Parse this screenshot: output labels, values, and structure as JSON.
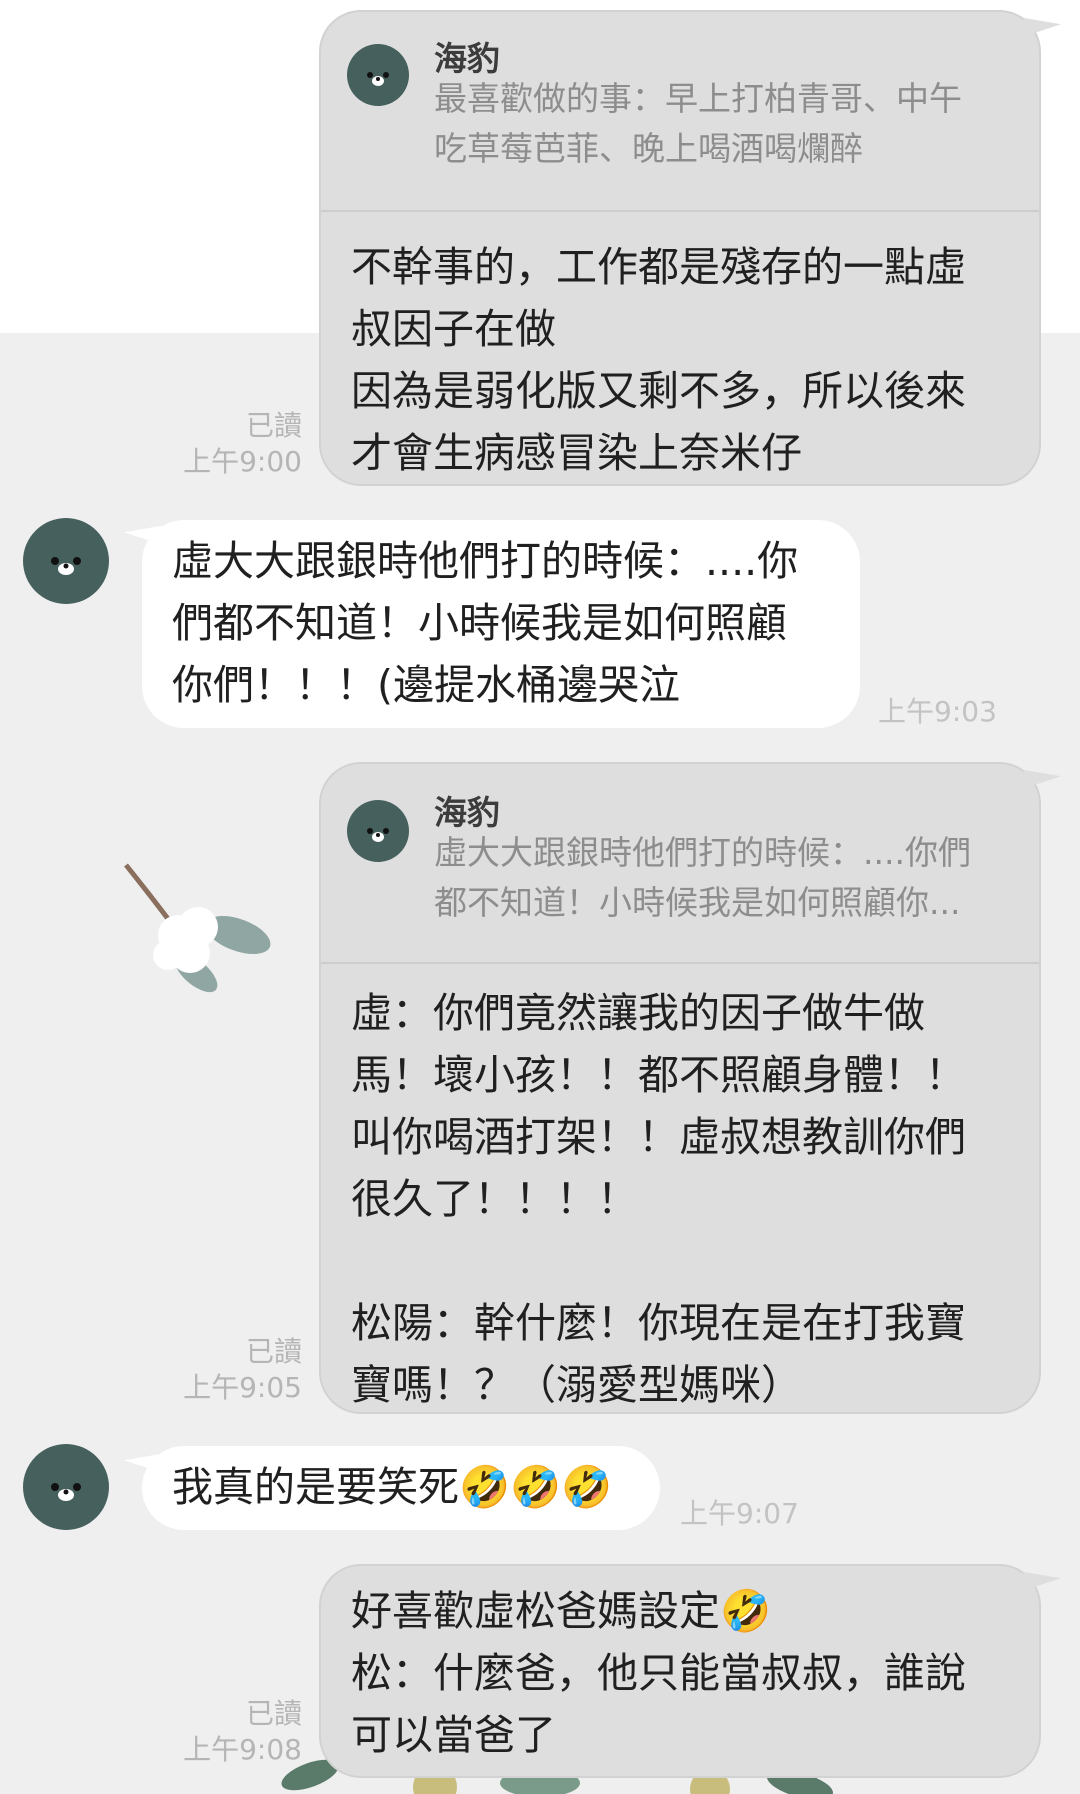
{
  "messages": [
    {
      "reply_name": "海豹",
      "reply_text": "最喜歡做的事：早上打柏青哥、中午\n吃草莓芭菲、晚上喝酒喝爛醉",
      "text": "不幹事的，工作都是殘存的一點虛\n叔因子在做\n因為是弱化版又剩不多，所以後來\n才會生病感冒染上奈米仔",
      "read": "已讀",
      "time": "上午9:00"
    },
    {
      "text": "虛大大跟銀時他們打的時候：....你\n們都不知道！小時候我是如何照顧\n你們！！！(邊提水桶邊哭泣",
      "time": "上午9:03"
    },
    {
      "reply_name": "海豹",
      "reply_text": "虛大大跟銀時他們打的時候：....你們\n都不知道！小時候我是如何照顧你...",
      "text": "虛：你們竟然讓我的因子做牛做\n馬！壞小孩！！都不照顧身體！！\n叫你喝酒打架！！虛叔想教訓你們\n很久了！！！！\n\n松陽：幹什麼！你現在是在打我寶\n寶嗎！？（溺愛型媽咪）",
      "read": "已讀",
      "time": "上午9:05"
    },
    {
      "text": "我真的是要笑死🤣🤣🤣",
      "time": "上午9:07"
    },
    {
      "text": "好喜歡虛松爸媽設定🤣\n松：什麼爸，他只能當叔叔，誰說\n可以當爸了",
      "read": "已讀",
      "time": "上午9:08"
    }
  ],
  "icons": {
    "avatar": "seal-avatar-icon",
    "decoration": "cotton-flower-branch"
  },
  "colors": {
    "outgoing_bubble": "#dedede",
    "incoming_bubble": "#ffffff",
    "avatar_bg": "#46605d",
    "chat_bg": "#efefef"
  }
}
